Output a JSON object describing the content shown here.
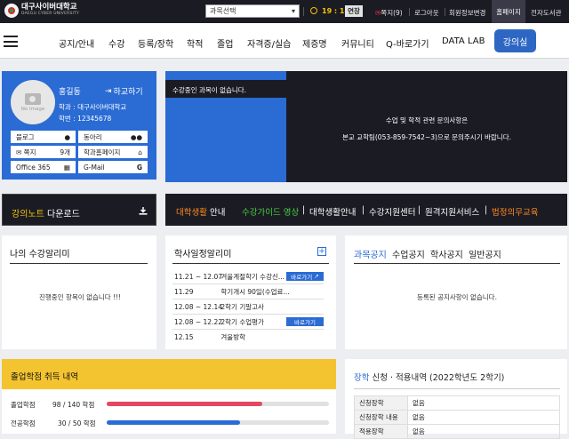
{
  "brand": {
    "name_ko": "대구사이버대학교",
    "name_en": "DAEGU CYBER UNIVERSITY"
  },
  "topbar": {
    "course_select": "과목선택",
    "clock": "19 : 14",
    "extend": "연장",
    "message": "쪽지(9)",
    "logout": "로그아웃",
    "member_info": "회원정보변경",
    "my_page": "홈페이지",
    "library": "전자도서관"
  },
  "nav": {
    "items": [
      "공지/안내",
      "수강",
      "등록/장학",
      "학적",
      "졸업",
      "자격증/실습",
      "제증명",
      "커뮤니티",
      "Q-바로가기",
      "DATA LAB"
    ],
    "lecture_room": "강의실"
  },
  "profile": {
    "avatar_text": "No Image",
    "name": "홍길동",
    "logout": "하교하기",
    "dept": "학과 : 대구사이버대학교",
    "student_id": "학번 : 12345678",
    "buttons": [
      {
        "label": "블로그",
        "icon": "user-icon"
      },
      {
        "label": "동아리",
        "icon": "group-icon"
      },
      {
        "label": "쪽지",
        "count": "9개"
      },
      {
        "label": "학과홈페이지",
        "icon": "home-icon"
      },
      {
        "label": "Office 365",
        "icon": "windows-icon"
      },
      {
        "label": "G-Mail",
        "icon": "google-icon"
      }
    ]
  },
  "courses": {
    "none": "수강중인 과목이 없습니다."
  },
  "contact": {
    "line1": "수업 및 학적 관련 문의사항은",
    "line2": "본교 교학팀(053-859-7542~3)으로 문의주시기 바랍니다."
  },
  "lecture_note": {
    "accent": "강의노트",
    "rest": "다운로드"
  },
  "guide": {
    "accent": "대학생활",
    "rest": "안내",
    "links": [
      "수강가이드 영상",
      "대학생활안내",
      "수강지원센터",
      "원격지원서비스",
      "법정의무교육"
    ],
    "separator": "|"
  },
  "alarms": {
    "title": "나의 수강알리미",
    "empty": "진행중인 항목이 없습니다 !!!"
  },
  "schedule": {
    "title": "학사일정알리미",
    "events": [
      {
        "date": "11.21 ~ 12.07",
        "text": "겨울계절학기 수강신...",
        "button": "바로가기"
      },
      {
        "date": "11.29",
        "text": "학기개시 90일(수업료...",
        "button": ""
      },
      {
        "date": "12.08 ~ 12.14",
        "text": "2학기 기말고사",
        "button": ""
      },
      {
        "date": "12.08 ~ 12.22",
        "text": "2학기 수업평가",
        "button": "바로가기"
      },
      {
        "date": "12.15",
        "text": "겨울방학",
        "button": ""
      }
    ]
  },
  "notices": {
    "tabs": [
      "과목공지",
      "수업공지",
      "학사공지",
      "일반공지"
    ],
    "empty": "등록된 공지사항이 없습니다."
  },
  "graduation": {
    "title": "졸업학점 취득 내역",
    "rows": [
      {
        "label": "졸업학점",
        "value": "98 / 140 학점",
        "fraction": 0.7,
        "color": "#e2485f"
      },
      {
        "label": "전공학점",
        "value": "30 / 50 학점",
        "fraction": 0.6,
        "color": "#2a6bd4"
      }
    ]
  },
  "scholarship": {
    "accent": "장학",
    "rest": "신청 · 적용내역 (2022학년도 2학기)",
    "rows": [
      {
        "k": "신청장학",
        "v": "없음"
      },
      {
        "k": "신청장학 내용",
        "v": "없음"
      },
      {
        "k": "적용장학",
        "v": "없음"
      }
    ]
  },
  "colors": {
    "blue": "#2a6bd4",
    "dark": "#1b1b24",
    "yellow": "#f4c430",
    "green": "#49d043",
    "orange": "#ff8a1d"
  }
}
